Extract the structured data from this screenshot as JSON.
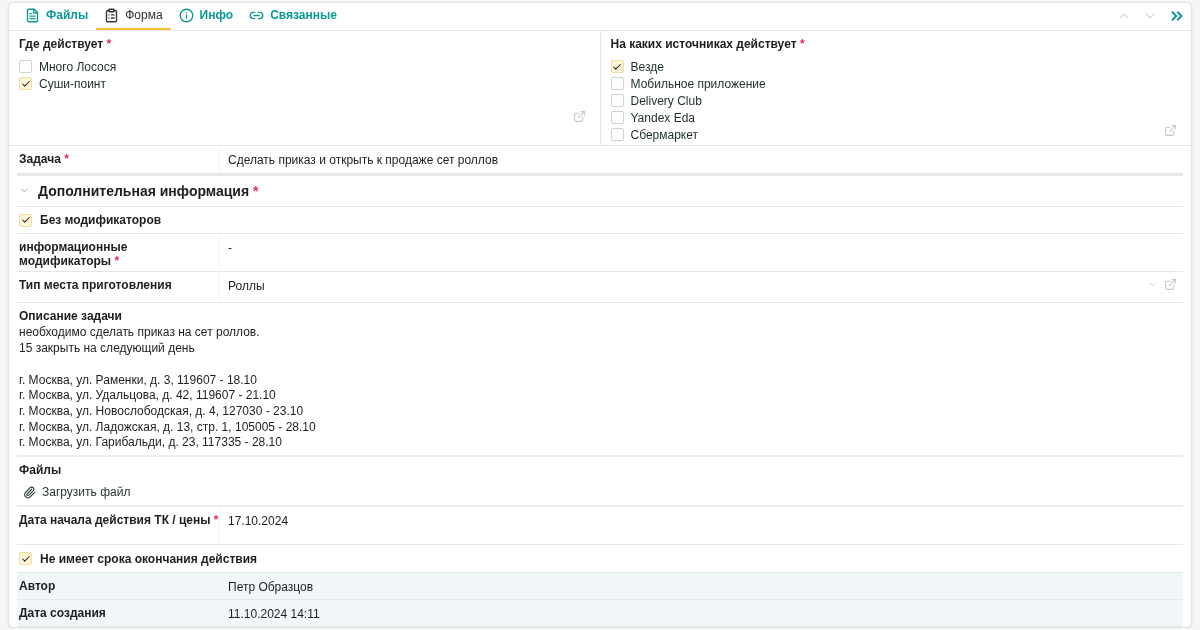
{
  "tabs": [
    {
      "label": "Файлы",
      "selected": false
    },
    {
      "label": "Форма",
      "selected": true
    },
    {
      "label": "Инфо",
      "selected": false
    },
    {
      "label": "Связанные",
      "selected": false
    }
  ],
  "where": {
    "label": "Где действует",
    "required_mark": "*",
    "options": [
      {
        "label": "Много Лосося",
        "checked": false
      },
      {
        "label": "Суши-поинт",
        "checked": true
      }
    ]
  },
  "sources": {
    "label": "На каких источниках действует",
    "required_mark": "*",
    "options": [
      {
        "label": "Везде",
        "checked": true
      },
      {
        "label": "Мобильное приложение",
        "checked": false
      },
      {
        "label": "Delivery Club",
        "checked": false
      },
      {
        "label": "Yandex Eda",
        "checked": false
      },
      {
        "label": "Сбермаркет",
        "checked": false
      }
    ]
  },
  "task": {
    "label": "Задача",
    "required_mark": "*",
    "value": "Сделать приказ и открыть к продаже сет роллов"
  },
  "section": {
    "title": "Дополнительная информация",
    "required_mark": "*",
    "expanded": true
  },
  "no_modifiers": {
    "label": "Без модификаторов",
    "checked": true
  },
  "info_modifiers": {
    "label": "информационные модификаторы",
    "required_mark": "*",
    "value": "-"
  },
  "cooking_place": {
    "label": "Тип места приготовления",
    "value": "Роллы"
  },
  "description": {
    "label": "Описание задачи",
    "text": "необходимо сделать приказ на сет роллов.\n15 закрыть на следующий день\n\nг. Москва, ул. Раменки, д. 3, 119607 - 18.10\nг. Москва, ул. Удальцова, д. 42, 119607 - 21.10\nг. Москва, ул. Новослободская, д. 4, 127030 - 23.10\nг. Москва, ул. Ладожская, д. 13, стр. 1, 105005 - 28.10\nг. Москва, ул. Гарибальди, д. 23, 117335 - 28.10"
  },
  "files": {
    "label": "Файлы",
    "upload": "Загрузить файл"
  },
  "start_date": {
    "label": "Дата начала действия ТК / цены",
    "required_mark": "*",
    "value": "17.10.2024"
  },
  "no_end": {
    "label": "Не имеет срока окончания действия",
    "checked": true
  },
  "meta": [
    {
      "label": "Автор",
      "value": "Петр Образцов"
    },
    {
      "label": "Дата создания",
      "value": "11.10.2024 14:11"
    }
  ]
}
